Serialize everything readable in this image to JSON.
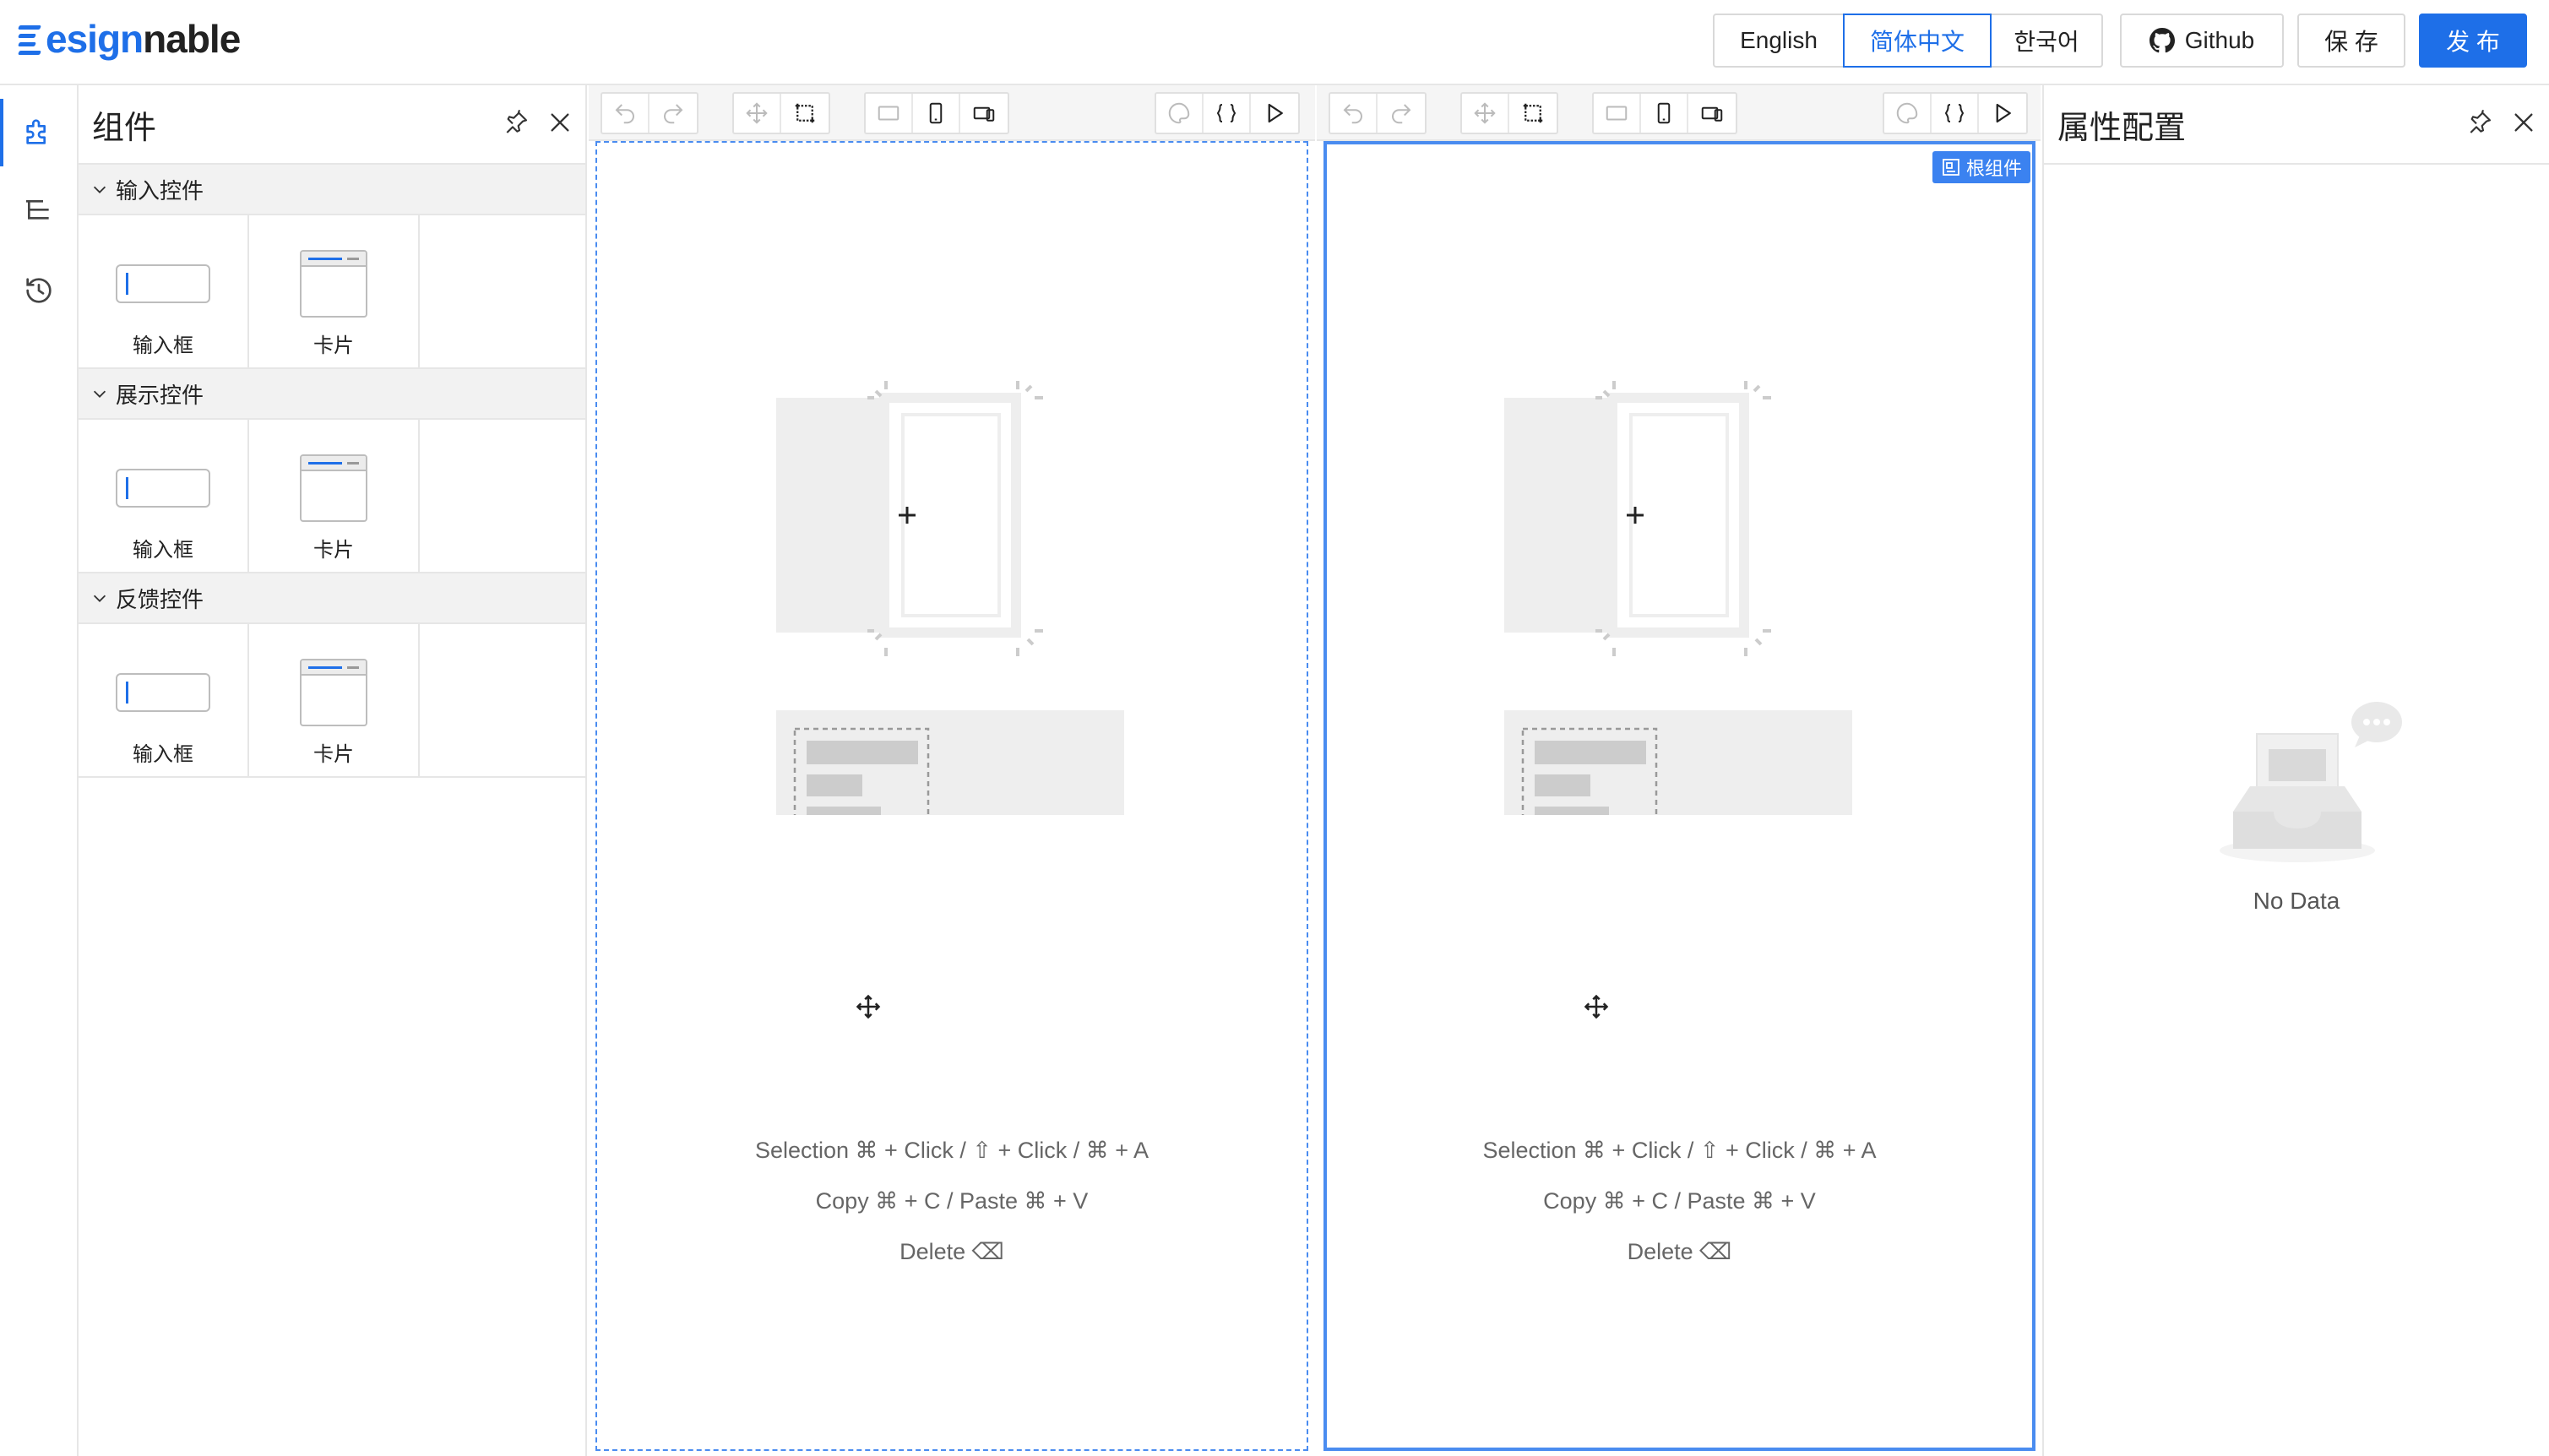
{
  "app": {
    "logo_accent": "esign",
    "logo_rest": "nable"
  },
  "header": {
    "languages": [
      {
        "label": "English",
        "active": false
      },
      {
        "label": "简体中文",
        "active": true
      },
      {
        "label": "한국어",
        "active": false
      }
    ],
    "github_label": "Github",
    "save_label": "保 存",
    "publish_label": "发 布"
  },
  "components_panel": {
    "title": "组件",
    "groups": [
      {
        "title": "输入控件",
        "items": [
          {
            "label": "输入框",
            "icon": "input-icon"
          },
          {
            "label": "卡片",
            "icon": "card-icon"
          }
        ]
      },
      {
        "title": "展示控件",
        "items": [
          {
            "label": "输入框",
            "icon": "input-icon"
          },
          {
            "label": "卡片",
            "icon": "card-icon"
          }
        ]
      },
      {
        "title": "反馈控件",
        "items": [
          {
            "label": "输入框",
            "icon": "input-icon"
          },
          {
            "label": "卡片",
            "icon": "card-icon"
          }
        ]
      }
    ]
  },
  "canvas": {
    "root_badge": "根组件",
    "hints": {
      "selection": "Selection ⌘ + Click / ⇧ + Click / ⌘ + A",
      "copy": "Copy ⌘ + C / Paste ⌘ + V",
      "delete": "Delete ⌫"
    }
  },
  "properties_panel": {
    "title": "属性配置",
    "empty_text": "No Data"
  },
  "colors": {
    "accent": "#1e6fe8",
    "canvas_outline": "#4a8cf0",
    "panel_border": "#e6e6e6"
  }
}
